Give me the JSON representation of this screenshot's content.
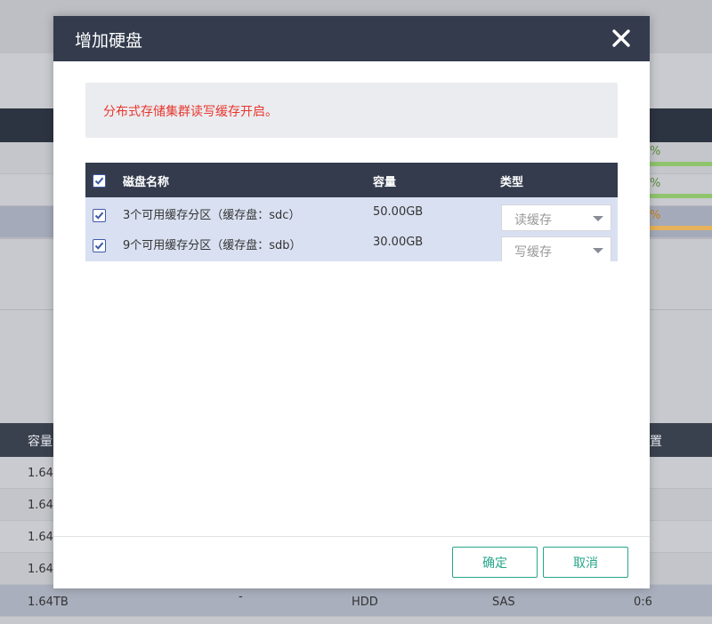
{
  "colors": {
    "header_bg": "#333b4d",
    "notice_text": "#e8372d",
    "button_accent": "#27a58a",
    "row_selected": "#d9e0f1"
  },
  "background": {
    "percent_suffix": "%",
    "table_headers": {
      "capacity": "容量",
      "location": "置"
    },
    "rows": [
      {
        "capacity": "1.64",
        "col3": ""
      },
      {
        "capacity": "1.64",
        "col3": ""
      },
      {
        "capacity": "1.64",
        "col3": ""
      },
      {
        "capacity": "1.64",
        "col3": ""
      },
      {
        "capacity": "1.64TB",
        "dash": "-",
        "type": "HDD",
        "iface": "SAS",
        "slot": "0:6"
      }
    ]
  },
  "dialog": {
    "title": "增加硬盘",
    "close_icon": "close-icon",
    "notice": "分布式存储集群读写缓存开启。",
    "table": {
      "headers": {
        "name": "磁盘名称",
        "capacity": "容量",
        "type": "类型"
      },
      "rows": [
        {
          "checked": true,
          "name": "3个可用缓存分区（缓存盘：sdc）",
          "capacity": "50.00GB",
          "type": "读缓存"
        },
        {
          "checked": true,
          "name": "9个可用缓存分区（缓存盘：sdb）",
          "capacity": "30.00GB",
          "type": "写缓存"
        }
      ]
    },
    "buttons": {
      "confirm": "确定",
      "cancel": "取消"
    }
  }
}
